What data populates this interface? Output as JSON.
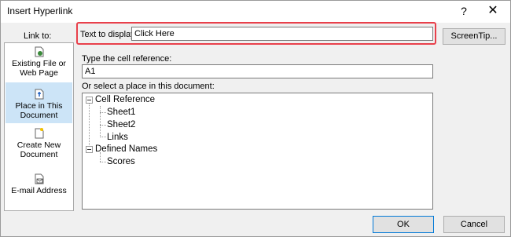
{
  "window": {
    "title": "Insert Hyperlink",
    "help_glyph": "?",
    "close_glyph": "✕"
  },
  "sidebar": {
    "heading": "Link to:",
    "items": [
      {
        "line1": "Existing File or",
        "line2": "Web Page",
        "icon": "web-page-icon",
        "selected": false
      },
      {
        "line1": "Place in This",
        "line2": "Document",
        "icon": "document-place-icon",
        "selected": true
      },
      {
        "line1": "Create New",
        "line2": "Document",
        "icon": "new-document-icon",
        "selected": false
      },
      {
        "line1": "E-mail Address",
        "line2": "",
        "icon": "email-icon",
        "selected": false
      }
    ]
  },
  "text_to_display": {
    "label": "Text to display:",
    "value": "Click Here",
    "highlight_color": "#e8404b"
  },
  "screentip_button": "ScreenTip...",
  "cell_reference": {
    "label": "Type the cell reference:",
    "value": "A1"
  },
  "place_in_document": {
    "label": "Or select a place in this document:",
    "tree": {
      "group1": "Cell Reference",
      "group1_items": [
        "Sheet1",
        "Sheet2",
        "Links"
      ],
      "group2": "Defined Names",
      "group2_items": [
        "Scores"
      ]
    }
  },
  "buttons": {
    "ok": "OK",
    "cancel": "Cancel"
  },
  "colors": {
    "selected_bg": "#cce4f7",
    "ok_border": "#0078d7"
  }
}
